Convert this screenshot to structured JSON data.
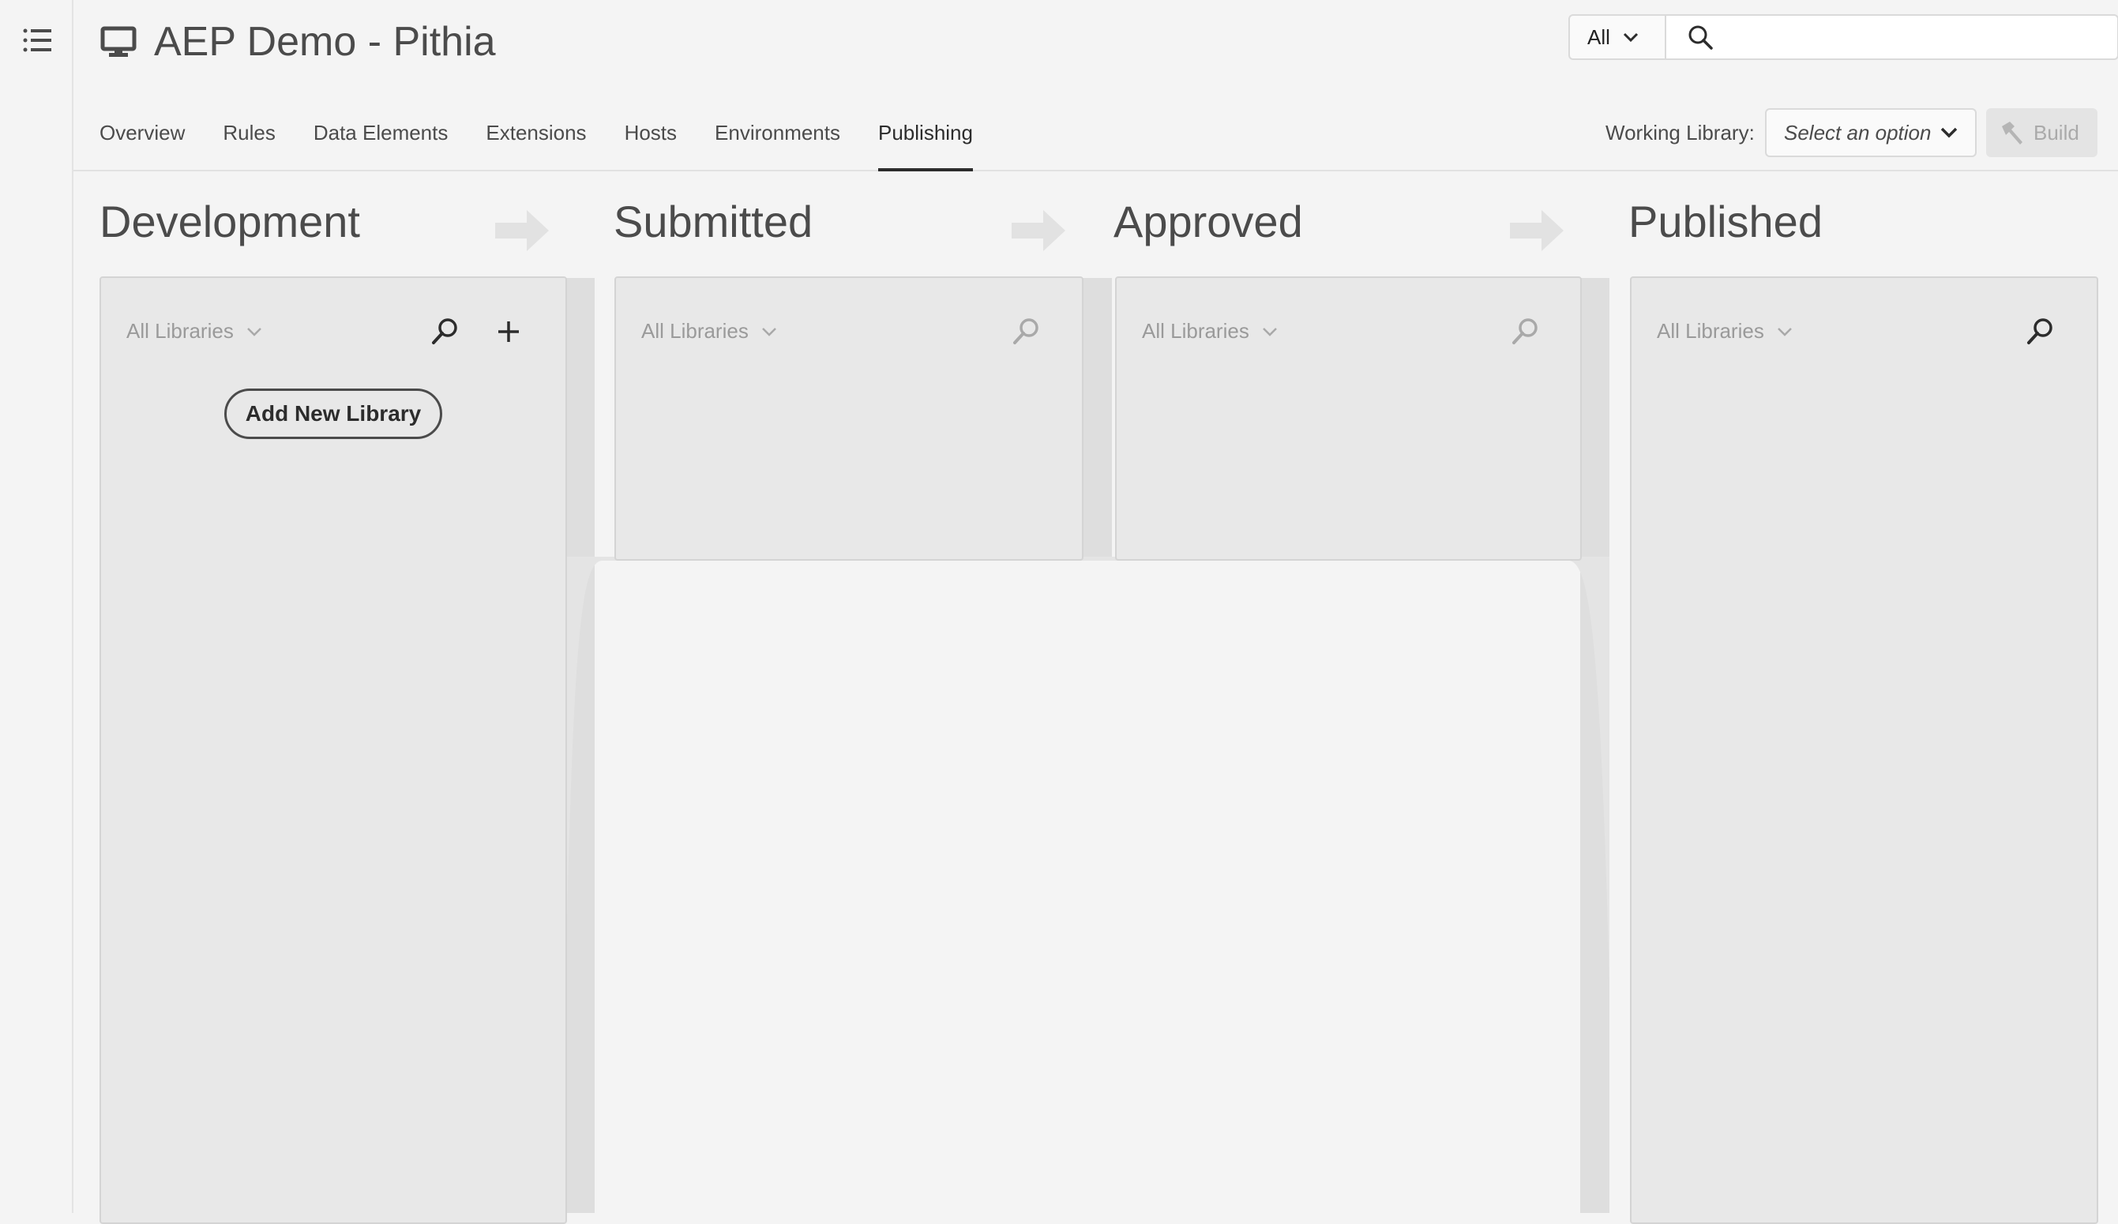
{
  "app": {
    "title": "AEP Demo - Pithia",
    "title_icon": "desktop-icon",
    "menu_icon": "list-icon"
  },
  "search": {
    "scope_value": "All",
    "placeholder": ""
  },
  "tabs": [
    {
      "label": "Overview"
    },
    {
      "label": "Rules"
    },
    {
      "label": "Data Elements"
    },
    {
      "label": "Extensions"
    },
    {
      "label": "Hosts"
    },
    {
      "label": "Environments"
    },
    {
      "label": "Publishing",
      "active": true
    }
  ],
  "working_library": {
    "label": "Working Library:",
    "select_placeholder": "Select an option",
    "build_label": "Build"
  },
  "stages": [
    {
      "title": "Development",
      "filter": "All Libraries",
      "add_button": "Add New Library"
    },
    {
      "title": "Submitted",
      "filter": "All Libraries"
    },
    {
      "title": "Approved",
      "filter": "All Libraries"
    },
    {
      "title": "Published",
      "filter": "All Libraries"
    }
  ],
  "colors": {
    "background": "#f4f4f4",
    "panel": "#e8e8e8",
    "text": "#2c2c2c",
    "muted": "#9a9a9a",
    "arrow": "#e2e2e2"
  }
}
